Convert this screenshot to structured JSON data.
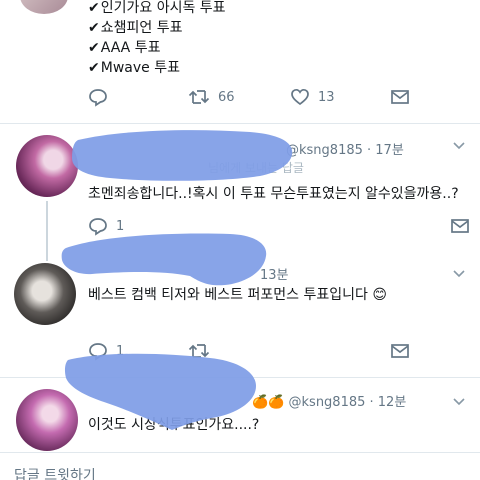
{
  "top_tweet": {
    "lines": [
      "인기가요 아시독 투표",
      "쇼챔피언 투표",
      "AAA 투표",
      "Mwave 투표"
    ],
    "check": "✔",
    "retweet_count": "66",
    "like_count": "13"
  },
  "reply1": {
    "handle_meta": "@ksng8185 · 17분",
    "faded_text": "님에게 보내는 답글",
    "text": "초멘죄송합니다..!혹시 이 투표 무슨투표였는지 알수있을까용..?",
    "reply_count": "1"
  },
  "reply2": {
    "time": "13분",
    "text": "베스트 컴백 티저와 베스트 퍼포먼스 투표입니다",
    "emoji": "😊",
    "reply_count": "1"
  },
  "reply3": {
    "emoji": "🍊🍊",
    "handle_meta": "@ksng8185 · 12분",
    "text": "이것도 시상식투표인가요....?"
  },
  "footer": {
    "reply_tweet": "답글 트윗하기"
  },
  "colors": {
    "muted": "#657786",
    "separator": "#e1e8ed",
    "redaction_blob": "#7f9de6"
  }
}
